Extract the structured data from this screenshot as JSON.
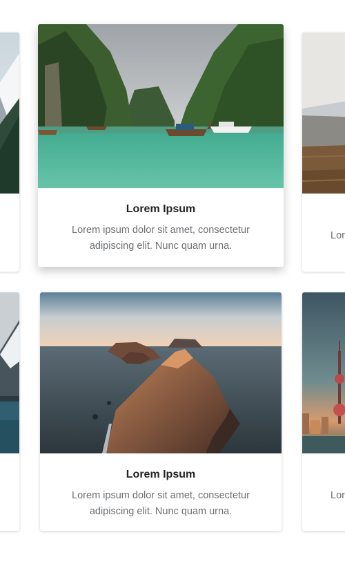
{
  "carousel_row_1": {
    "left_card": {
      "image": "snowy-mountain-forest-photo"
    },
    "center_card": {
      "image": "tropical-lagoon-longtail-boat-photo",
      "title": "Lorem Ipsum",
      "description": "Lorem ipsum dolor sit amet, consectetur adipiscing elit. Nunc quam urna."
    },
    "right_card": {
      "image": "desert-plains-photo",
      "description_fragment": "Lor"
    }
  },
  "carousel_row_2": {
    "left_card": {
      "image": "mountain-lake-photo"
    },
    "center_card": {
      "image": "coastal-rock-islands-sunset-photo",
      "title": "Lorem Ipsum",
      "description": "Lorem ipsum dolor sit amet, consectetur adipiscing elit. Nunc quam urna."
    },
    "right_card": {
      "image": "city-tower-skyline-photo",
      "description_fragment": "Lor"
    }
  }
}
